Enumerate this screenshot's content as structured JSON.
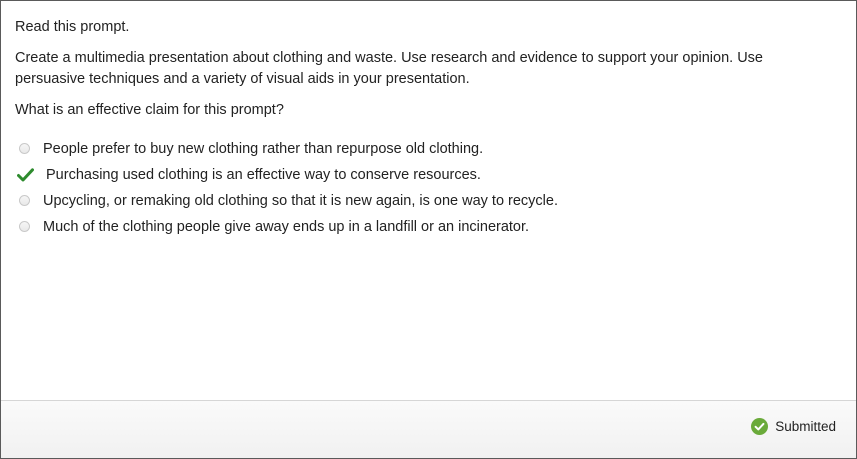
{
  "question": {
    "intro": "Read this prompt.",
    "prompt": "Create a multimedia presentation about clothing and waste. Use research and evidence to support your opinion. Use persuasive techniques and a variety of visual aids in your presentation.",
    "ask": "What is an effective claim for this prompt?"
  },
  "options": [
    {
      "label": "People prefer to buy new clothing rather than repurpose old clothing.",
      "selected": false
    },
    {
      "label": "Purchasing used clothing is an effective way to conserve resources.",
      "selected": true
    },
    {
      "label": "Upcycling, or remaking old clothing so that it is new again, is one way to recycle.",
      "selected": false
    },
    {
      "label": "Much of the clothing people give away ends up in a landfill or an incinerator.",
      "selected": false
    }
  ],
  "footer": {
    "status_label": "Submitted",
    "status_icon": "check-circle-icon"
  },
  "colors": {
    "check_green": "#2e8b2e",
    "status_green": "#6aaa3a",
    "border": "#5a5a5a",
    "footer_bg": "#f3f3f3"
  }
}
